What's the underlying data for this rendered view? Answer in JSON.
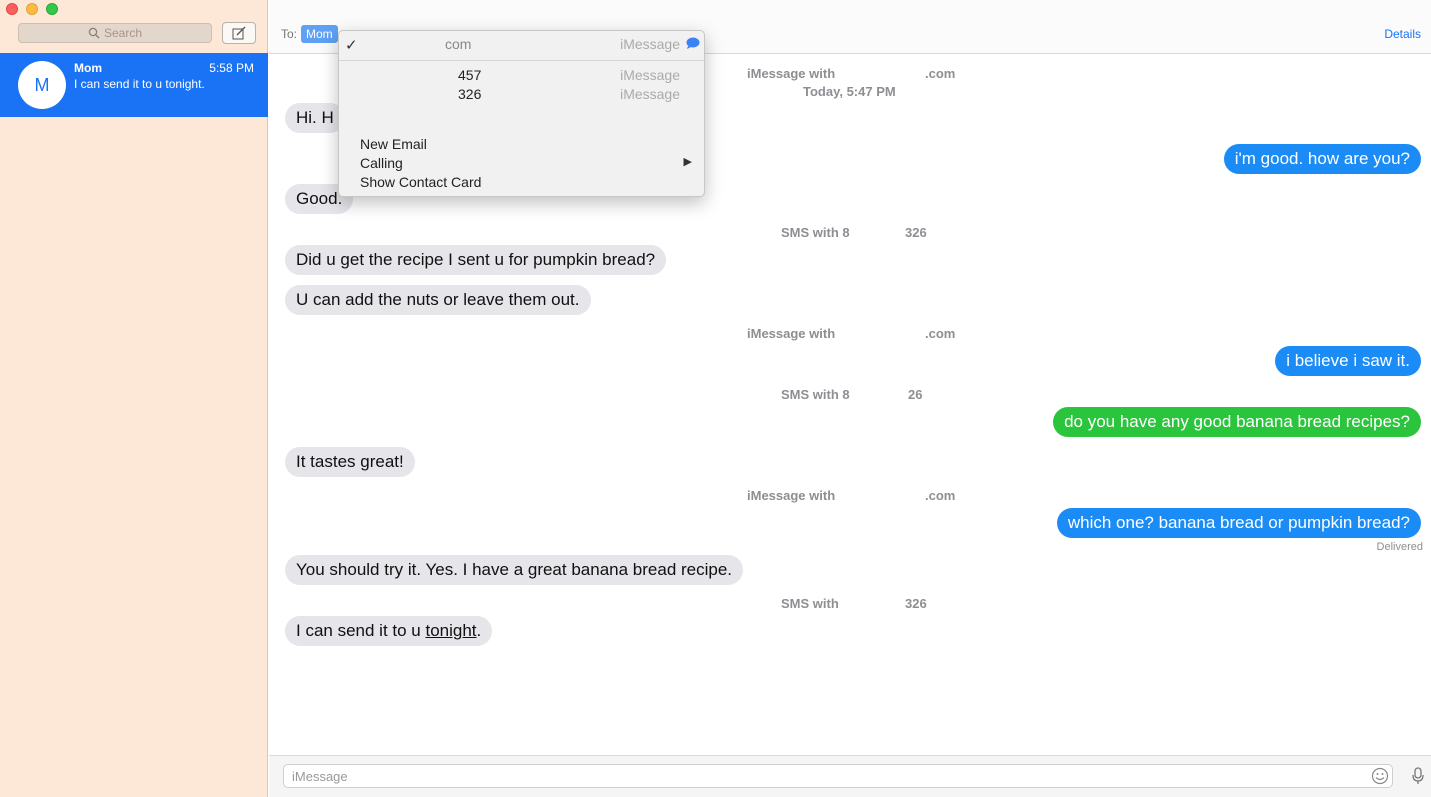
{
  "sidebar": {
    "search_placeholder": "Search",
    "conversation": {
      "initial": "M",
      "name": "Mom",
      "time": "5:58 PM",
      "preview": "I can send it to u tonight."
    }
  },
  "header": {
    "to_label": "To:",
    "recipient": "Mom",
    "details": "Details"
  },
  "transcript": {
    "service_1a": "iMessage with",
    "service_1b": ".com",
    "timestamp_1": "Today, 5:47 PM",
    "msg_1": "Hi.  H",
    "msg_2": "i'm good. how are you?",
    "msg_3": "Good.",
    "service_2a": "SMS with 8",
    "service_2b": "326",
    "msg_4": "Did u get the recipe I sent u for pumpkin bread?",
    "msg_5": "U can add the nuts or leave them out.",
    "service_3a": "iMessage with",
    "service_3b": ".com",
    "msg_6": "i believe i saw it.",
    "service_4a": "SMS with 8",
    "service_4b": "26",
    "msg_7": "do you have any good banana bread recipes?",
    "msg_8": "It tastes great!",
    "service_5a": "iMessage with",
    "service_5b": ".com",
    "msg_9": "which one? banana bread or pumpkin bread?",
    "delivered": "Delivered",
    "msg_10": "You should try it.  Yes. I have a great banana bread recipe.",
    "service_6a": "SMS with",
    "service_6b": "326",
    "msg_11_pre": "I can send it to u ",
    "msg_11_link": "tonight",
    "msg_11_post": "."
  },
  "menu": {
    "check": "✓",
    "row1_addr": "com",
    "row1_service": "iMessage",
    "row2_addr": "457",
    "row2_service": "iMessage",
    "row3_addr": "326",
    "row3_service": "iMessage",
    "new_email": "New Email",
    "calling": "Calling",
    "calling_arrow": "▶",
    "show_contact_card": "Show Contact Card"
  },
  "input": {
    "placeholder": "iMessage"
  },
  "colors": {
    "blue_bubble": "#1b8cf5",
    "green_bubble": "#2bc43d",
    "selection": "#1a73f5"
  }
}
